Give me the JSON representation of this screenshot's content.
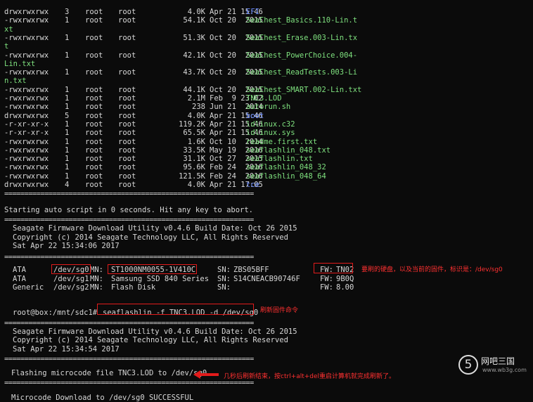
{
  "listing": [
    {
      "perm": "drwxrwxrwx",
      "links": "3",
      "owner": "root",
      "group": "root",
      "size": "4.0K",
      "date": "Apr 21 15:46",
      "name": "EFI",
      "type": "dir"
    },
    {
      "perm": "-rwxrwxrwx",
      "links": "1",
      "owner": "root",
      "group": "root",
      "size": "54.1K",
      "date": "Oct 20  2015",
      "name": "SeaChest_Basics.110-Lin.t",
      "cont": "xt",
      "type": "exe"
    },
    {
      "perm": "-rwxrwxrwx",
      "links": "1",
      "owner": "root",
      "group": "root",
      "size": "51.3K",
      "date": "Oct 20  2015",
      "name": "SeaChest_Erase.003-Lin.tx",
      "cont": "t",
      "type": "exe"
    },
    {
      "perm": "-rwxrwxrwx",
      "links": "1",
      "owner": "root",
      "group": "root",
      "size": "42.1K",
      "date": "Oct 20  2015",
      "name": "SeaChest_PowerChoice.004-",
      "cont": "Lin.txt",
      "type": "exe"
    },
    {
      "perm": "-rwxrwxrwx",
      "links": "1",
      "owner": "root",
      "group": "root",
      "size": "43.7K",
      "date": "Oct 20  2015",
      "name": "SeaChest_ReadTests.003-Li",
      "cont": "n.txt",
      "type": "exe"
    },
    {
      "perm": "-rwxrwxrwx",
      "links": "1",
      "owner": "root",
      "group": "root",
      "size": "44.1K",
      "date": "Oct 20  2015",
      "name": "SeaChest_SMART.002-Lin.txt",
      "type": "exe"
    },
    {
      "perm": "-rwxrwxrwx",
      "links": "1",
      "owner": "root",
      "group": "root",
      "size": "2.1M",
      "date": "Feb  9 23:02",
      "name": "TNC3.LOD",
      "type": "exe"
    },
    {
      "perm": "-rwxrwxrwx",
      "links": "1",
      "owner": "root",
      "group": "root",
      "size": "238",
      "date": "Jun 21  2014",
      "name": "autorun.sh",
      "type": "exe"
    },
    {
      "perm": "drwxrwxrwx",
      "links": "5",
      "owner": "root",
      "group": "root",
      "size": "4.0K",
      "date": "Apr 21 15:46",
      "name": "boot",
      "type": "dir"
    },
    {
      "perm": "-r-xr-xr-x",
      "links": "1",
      "owner": "root",
      "group": "root",
      "size": "119.2K",
      "date": "Apr 21 15:46",
      "name": "ldlinux.c32",
      "type": "exe"
    },
    {
      "perm": "-r-xr-xr-x",
      "links": "1",
      "owner": "root",
      "group": "root",
      "size": "65.5K",
      "date": "Apr 21 15:46",
      "name": "ldlinux.sys",
      "type": "exe"
    },
    {
      "perm": "-rwxrwxrwx",
      "links": "1",
      "owner": "root",
      "group": "root",
      "size": "1.6K",
      "date": "Oct 10  2014",
      "name": "readme.first.txt",
      "type": "exe"
    },
    {
      "perm": "-rwxrwxrwx",
      "links": "1",
      "owner": "root",
      "group": "root",
      "size": "33.5K",
      "date": "May 19  2016",
      "name": "seaflashlin_048.txt",
      "type": "exe"
    },
    {
      "perm": "-rwxrwxrwx",
      "links": "1",
      "owner": "root",
      "group": "root",
      "size": "31.1K",
      "date": "Oct 27  2015",
      "name": "seaflashlin.txt",
      "type": "exe"
    },
    {
      "perm": "-rwxrwxrwx",
      "links": "1",
      "owner": "root",
      "group": "root",
      "size": "95.6K",
      "date": "Feb 24  2016",
      "name": "seaflashlin_048_32",
      "type": "exe"
    },
    {
      "perm": "-rwxrwxrwx",
      "links": "1",
      "owner": "root",
      "group": "root",
      "size": "121.5K",
      "date": "Feb 24  2016",
      "name": "seaflashlin_048_64",
      "type": "exe"
    },
    {
      "perm": "drwxrwxrwx",
      "links": "4",
      "owner": "root",
      "group": "root",
      "size": "4.0K",
      "date": "Apr 21 17:05",
      "name": "tce",
      "type": "dir"
    }
  ],
  "separator": "==============================================================",
  "auto_script": "Starting auto script in 0 seconds. Hit any key to abort.",
  "banner1": [
    "Seagate Firmware Download Utility v0.4.6 Build Date: Oct 26 2015",
    "Copyright (c) 2014 Seagate Technology LLC, All Rights Reserved",
    "Sat Apr 22 15:34:06 2017"
  ],
  "devices": [
    {
      "type": "ATA",
      "dev": "/dev/sg0",
      "mn": "ST1000NM0055-1V410C",
      "sn": "ZBS05BFF",
      "fw": "TN02"
    },
    {
      "type": "ATA",
      "dev": "/dev/sg1",
      "mn": "Samsung SSD 840 Series",
      "sn": "S14CNEACB90746F",
      "fw": "9B0Q"
    },
    {
      "type": "Generic",
      "dev": "/dev/sg2",
      "mn": "Flash Disk",
      "sn": "",
      "fw": "8.00"
    }
  ],
  "labels": {
    "mn": "MN:",
    "sn": "SN:",
    "fw": "FW:"
  },
  "prompt": "root@box:/mnt/sdc1#",
  "command": "seaflashlin -f TNC3.LOD -d /dev/sg0",
  "banner2": [
    "Seagate Firmware Download Utility v0.4.6 Build Date: Oct 26 2015",
    "Copyright (c) 2014 Seagate Technology LLC, All Rights Reserved",
    "Sat Apr 22 15:34:54 2017"
  ],
  "flashing": "Flashing microcode file TNC3.LOD to /dev/sg0",
  "result": "Microcode Download to /dev/sg0 SUCCESSFUL",
  "notes": {
    "device": "要刷的硬盘，以及当前的固件，标识是：/dev/sg0",
    "command": "刷新固件命令",
    "success": "几秒后刷新结束，按ctrl+alt+del重启计算机就完成刷新了。"
  },
  "watermark": {
    "mark": "5",
    "title": "网吧三国",
    "url": "www.wb3g.com"
  },
  "colors": {
    "dir": "#6a8cff",
    "exe": "#7ee07e",
    "annotation": "#e21b1b",
    "text": "#d8d8d8",
    "background": "#0b0b0b"
  }
}
